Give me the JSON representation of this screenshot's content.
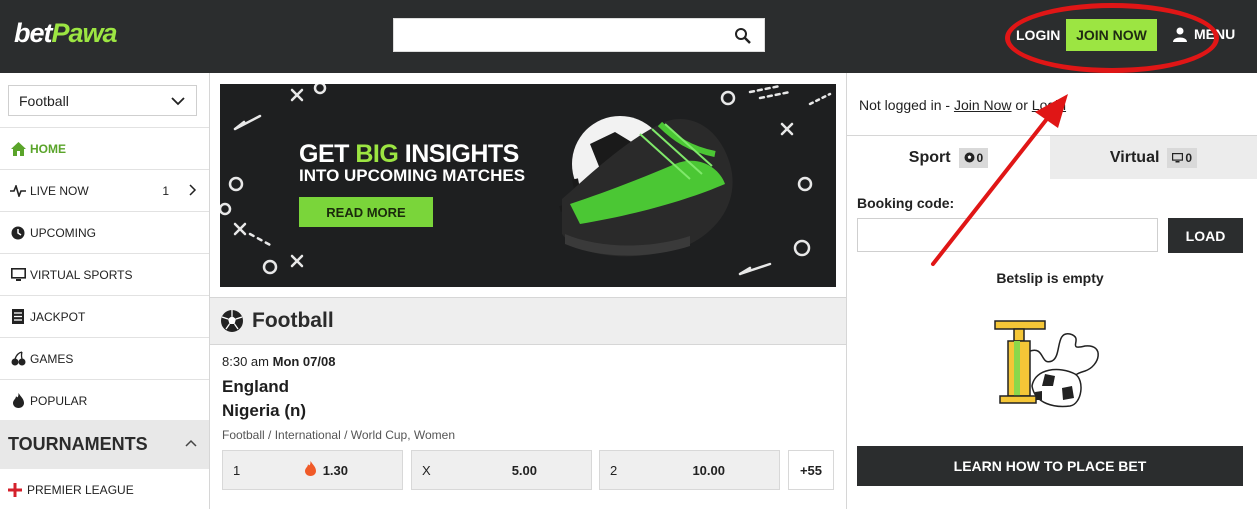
{
  "header": {
    "logo_bet": "bet",
    "logo_pawa": "Pawa",
    "search_placeholder": "",
    "login": "LOGIN",
    "join_now": "JOIN NOW",
    "menu": "MENU"
  },
  "sidebar": {
    "sport_selected": "Football",
    "items": [
      {
        "label": "HOME",
        "icon": "home-icon"
      },
      {
        "label": "LIVE NOW",
        "icon": "pulse-icon",
        "count": "1"
      },
      {
        "label": "UPCOMING",
        "icon": "clock-icon"
      },
      {
        "label": "VIRTUAL SPORTS",
        "icon": "monitor-icon"
      },
      {
        "label": "JACKPOT",
        "icon": "ticket-icon"
      },
      {
        "label": "GAMES",
        "icon": "cherries-icon"
      },
      {
        "label": "POPULAR",
        "icon": "flame-icon"
      }
    ],
    "tournaments_title": "TOURNAMENTS",
    "premier_league": "PREMIER LEAGUE"
  },
  "banner": {
    "line1_a": "GET",
    "line1_b": "BIG",
    "line1_c": "INSIGHTS",
    "line2": "INTO UPCOMING MATCHES",
    "cta": "READ MORE"
  },
  "section": {
    "title": "Football"
  },
  "match": {
    "time": "8:30 am",
    "date": "Mon 07/08",
    "home": "England",
    "away": "Nigeria (n)",
    "meta": "Football / International / World Cup, Women",
    "odds": [
      {
        "key": "1",
        "value": "1.30"
      },
      {
        "key": "X",
        "value": "5.00"
      },
      {
        "key": "2",
        "value": "10.00"
      }
    ],
    "more": "+55"
  },
  "betslip": {
    "not_logged": "Not logged in - ",
    "join_now": "Join Now",
    "or": " or ",
    "login": "Login",
    "tab_sport": "Sport",
    "tab_sport_count": "0",
    "tab_virtual": "Virtual",
    "tab_virtual_count": "0",
    "booking_label": "Booking code:",
    "load": "LOAD",
    "empty": "Betslip is empty",
    "learn": "LEARN HOW TO PLACE BET"
  },
  "colors": {
    "brand_green": "#9ce542",
    "header_dark": "#2b2d2e",
    "annotation_red": "#e01616"
  }
}
